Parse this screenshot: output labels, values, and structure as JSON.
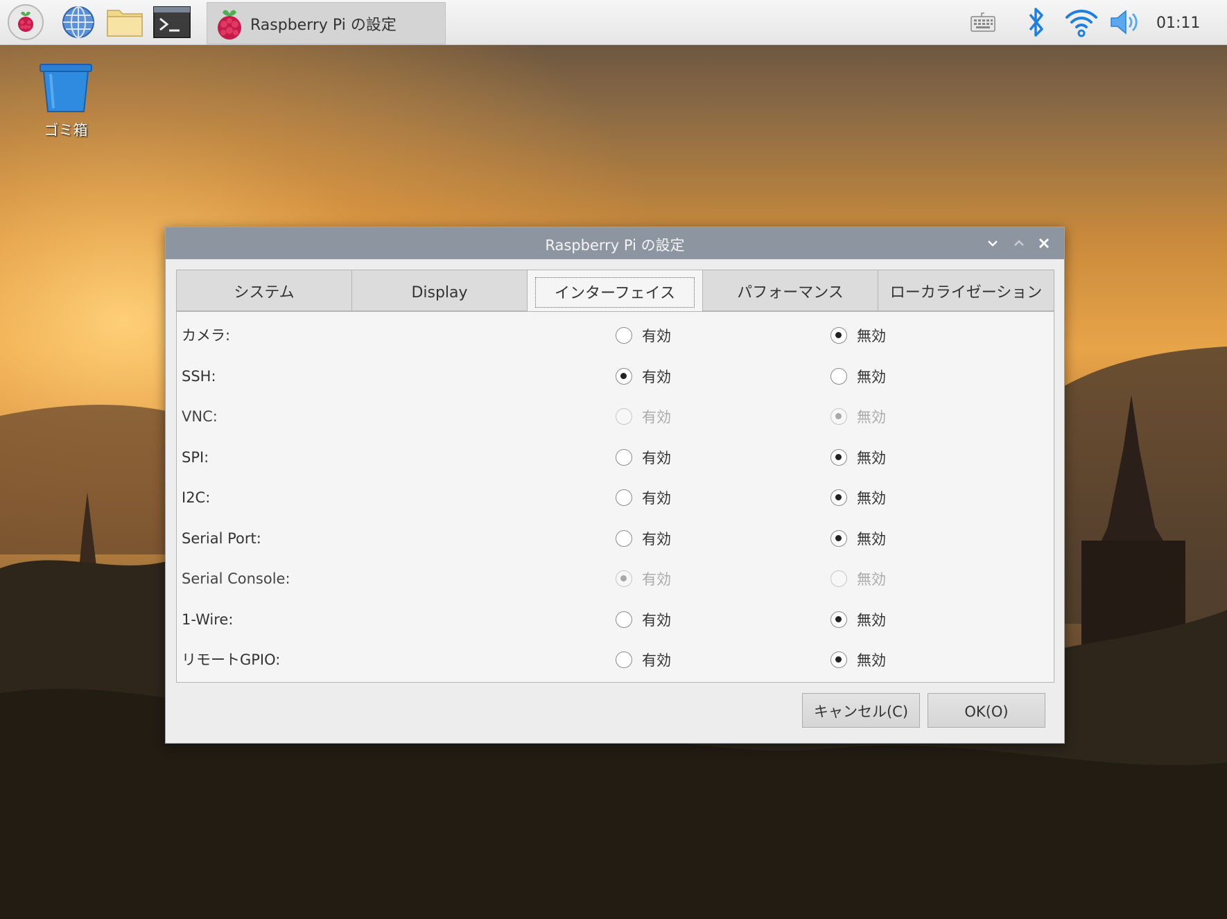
{
  "taskbar": {
    "menu_icon": "raspberry-icon",
    "browser_icon": "globe-icon",
    "files_icon": "folder-icon",
    "terminal_icon": "terminal-icon",
    "task_label": "Raspberry Pi の設定",
    "clock": "01:11",
    "tray_icons": [
      "keyboard-icon",
      "bluetooth-icon",
      "wifi-icon",
      "volume-icon"
    ]
  },
  "desktop": {
    "trash_label": "ゴミ箱"
  },
  "dialog": {
    "title": "Raspberry Pi の設定",
    "tabs": [
      "システム",
      "Display",
      "インターフェイス",
      "パフォーマンス",
      "ローカライゼーション"
    ],
    "active_tab": "インターフェイス",
    "enable_label": "有効",
    "disable_label": "無効",
    "rows": [
      {
        "label": "カメラ:",
        "value": "無効",
        "disabled": false
      },
      {
        "label": "SSH:",
        "value": "有効",
        "disabled": false
      },
      {
        "label": "VNC:",
        "value": "無効",
        "disabled": true
      },
      {
        "label": "SPI:",
        "value": "無効",
        "disabled": false
      },
      {
        "label": "I2C:",
        "value": "無効",
        "disabled": false
      },
      {
        "label": "Serial Port:",
        "value": "無効",
        "disabled": false
      },
      {
        "label": "Serial Console:",
        "value": "有効",
        "disabled": true
      },
      {
        "label": "1-Wire:",
        "value": "無効",
        "disabled": false
      },
      {
        "label": "リモートGPIO:",
        "value": "無効",
        "disabled": false
      }
    ],
    "cancel_label": "キャンセル(C)",
    "ok_label": "OK(O)"
  }
}
